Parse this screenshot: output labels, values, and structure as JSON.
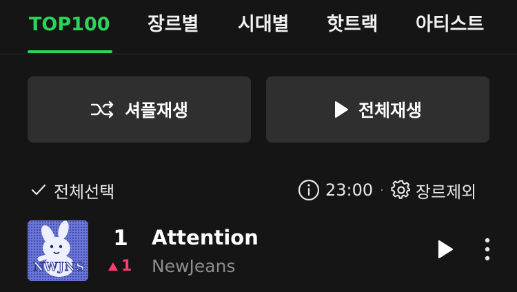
{
  "tabs": [
    {
      "label": "TOP100",
      "active": true
    },
    {
      "label": "장르별"
    },
    {
      "label": "시대별"
    },
    {
      "label": "핫트랙"
    },
    {
      "label": "아티스트"
    }
  ],
  "actions": {
    "shuffle_label": "셔플재생",
    "play_all_label": "전체재생"
  },
  "toolbar": {
    "select_all_label": "전체선택",
    "time": "23:00",
    "separator": "·",
    "genre_exclude_label": "장르제외"
  },
  "tracks": [
    {
      "rank": "1",
      "rank_change": "1",
      "rank_change_direction": "up",
      "title": "Attention",
      "artist": "NewJeans",
      "album_art_text": "NWJNS"
    }
  ],
  "colors": {
    "accent": "#2ed35a",
    "background": "#151515",
    "button_bg": "#2f2f2f",
    "rank_up": "#ff3c6e",
    "secondary_text": "#8d8d8d"
  },
  "icons": {
    "shuffle": "shuffle-icon",
    "play": "play-icon",
    "check": "check-icon",
    "info": "info-icon",
    "gear": "gear-icon",
    "more": "more-vertical-icon",
    "rank_up": "triangle-up-icon"
  }
}
